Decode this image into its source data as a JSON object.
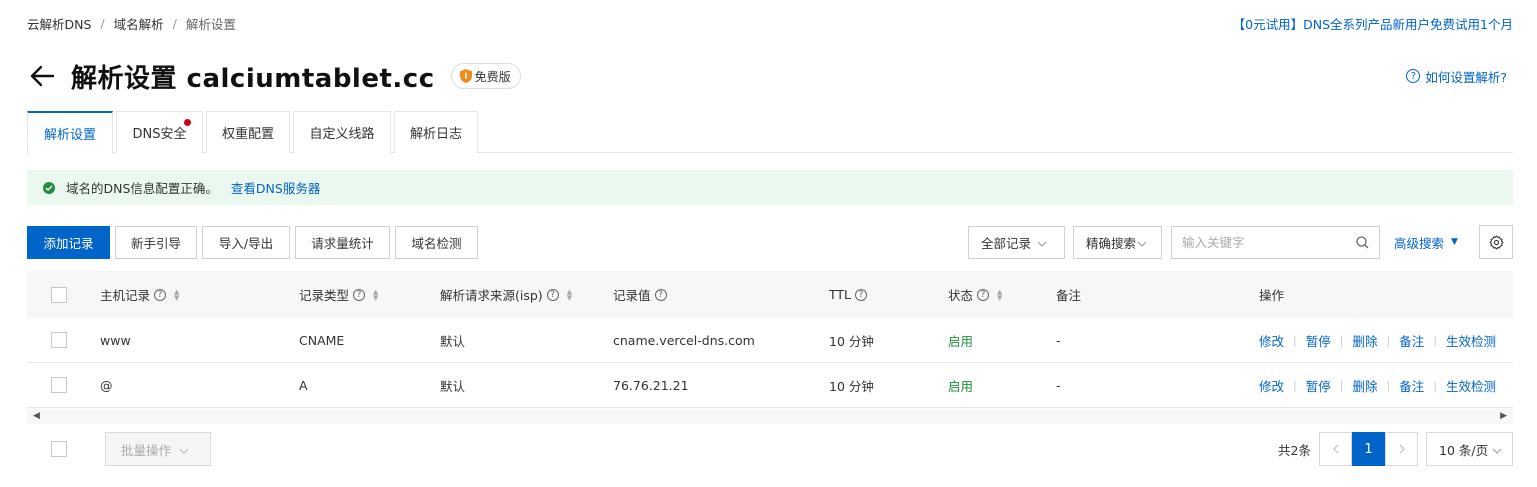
{
  "breadcrumb": [
    "云解析DNS",
    "域名解析",
    "解析设置"
  ],
  "breadcrumb_sep": "/",
  "promo": "【0元试用】DNS全系列产品新用户免费试用1个月",
  "header": {
    "title": "解析设置 calciumtablet.cc",
    "badge": "免费版",
    "help": "如何设置解析?"
  },
  "tabs": [
    {
      "label": "解析设置",
      "active": true
    },
    {
      "label": "DNS安全",
      "dot": true
    },
    {
      "label": "权重配置"
    },
    {
      "label": "自定义线路"
    },
    {
      "label": "解析日志"
    }
  ],
  "alert": {
    "text": "域名的DNS信息配置正确。",
    "link": "查看DNS服务器"
  },
  "toolbar": {
    "add": "添加记录",
    "guide": "新手引导",
    "import_export": "导入/导出",
    "stats": "请求量统计",
    "check": "域名检测",
    "filter_all": "全部记录",
    "filter_mode": "精确搜索",
    "search_placeholder": "输入关键字",
    "advanced": "高级搜索"
  },
  "table": {
    "columns": {
      "host": "主机记录",
      "type": "记录类型",
      "isp": "解析请求来源(isp)",
      "value": "记录值",
      "ttl": "TTL",
      "status": "状态",
      "remark": "备注",
      "ops": "操作"
    },
    "rows": [
      {
        "host": "www",
        "type": "CNAME",
        "isp": "默认",
        "value": "cname.vercel-dns.com",
        "ttl": "10 分钟",
        "status": "启用",
        "remark": "-"
      },
      {
        "host": "@",
        "type": "A",
        "isp": "默认",
        "value": "76.76.21.21",
        "ttl": "10 分钟",
        "status": "启用",
        "remark": "-"
      }
    ],
    "ops": [
      "修改",
      "暂停",
      "删除",
      "备注",
      "生效检测"
    ]
  },
  "footer": {
    "bulk": "批量操作",
    "total": "共2条",
    "current_page": "1",
    "page_size": "10 条/页"
  },
  "colors": {
    "primary": "#0064c8",
    "success": "#1e8e3e",
    "alert_bg": "#ebf8ef",
    "badge_dot": "#d0021b"
  }
}
